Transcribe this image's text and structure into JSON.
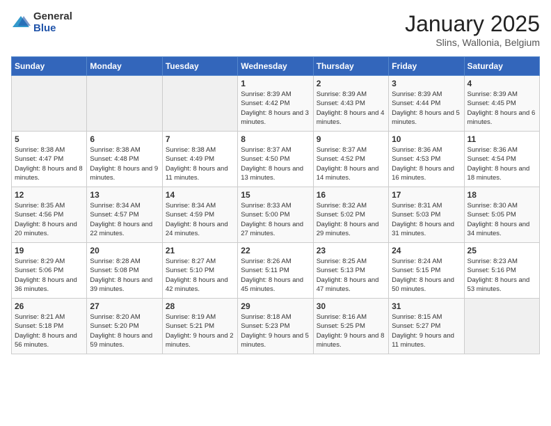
{
  "logo": {
    "general": "General",
    "blue": "Blue"
  },
  "header": {
    "month": "January 2025",
    "location": "Slins, Wallonia, Belgium"
  },
  "weekdays": [
    "Sunday",
    "Monday",
    "Tuesday",
    "Wednesday",
    "Thursday",
    "Friday",
    "Saturday"
  ],
  "weeks": [
    [
      {
        "day": "",
        "sunrise": "",
        "sunset": "",
        "daylight": ""
      },
      {
        "day": "",
        "sunrise": "",
        "sunset": "",
        "daylight": ""
      },
      {
        "day": "",
        "sunrise": "",
        "sunset": "",
        "daylight": ""
      },
      {
        "day": "1",
        "sunrise": "Sunrise: 8:39 AM",
        "sunset": "Sunset: 4:42 PM",
        "daylight": "Daylight: 8 hours and 3 minutes."
      },
      {
        "day": "2",
        "sunrise": "Sunrise: 8:39 AM",
        "sunset": "Sunset: 4:43 PM",
        "daylight": "Daylight: 8 hours and 4 minutes."
      },
      {
        "day": "3",
        "sunrise": "Sunrise: 8:39 AM",
        "sunset": "Sunset: 4:44 PM",
        "daylight": "Daylight: 8 hours and 5 minutes."
      },
      {
        "day": "4",
        "sunrise": "Sunrise: 8:39 AM",
        "sunset": "Sunset: 4:45 PM",
        "daylight": "Daylight: 8 hours and 6 minutes."
      }
    ],
    [
      {
        "day": "5",
        "sunrise": "Sunrise: 8:38 AM",
        "sunset": "Sunset: 4:47 PM",
        "daylight": "Daylight: 8 hours and 8 minutes."
      },
      {
        "day": "6",
        "sunrise": "Sunrise: 8:38 AM",
        "sunset": "Sunset: 4:48 PM",
        "daylight": "Daylight: 8 hours and 9 minutes."
      },
      {
        "day": "7",
        "sunrise": "Sunrise: 8:38 AM",
        "sunset": "Sunset: 4:49 PM",
        "daylight": "Daylight: 8 hours and 11 minutes."
      },
      {
        "day": "8",
        "sunrise": "Sunrise: 8:37 AM",
        "sunset": "Sunset: 4:50 PM",
        "daylight": "Daylight: 8 hours and 13 minutes."
      },
      {
        "day": "9",
        "sunrise": "Sunrise: 8:37 AM",
        "sunset": "Sunset: 4:52 PM",
        "daylight": "Daylight: 8 hours and 14 minutes."
      },
      {
        "day": "10",
        "sunrise": "Sunrise: 8:36 AM",
        "sunset": "Sunset: 4:53 PM",
        "daylight": "Daylight: 8 hours and 16 minutes."
      },
      {
        "day": "11",
        "sunrise": "Sunrise: 8:36 AM",
        "sunset": "Sunset: 4:54 PM",
        "daylight": "Daylight: 8 hours and 18 minutes."
      }
    ],
    [
      {
        "day": "12",
        "sunrise": "Sunrise: 8:35 AM",
        "sunset": "Sunset: 4:56 PM",
        "daylight": "Daylight: 8 hours and 20 minutes."
      },
      {
        "day": "13",
        "sunrise": "Sunrise: 8:34 AM",
        "sunset": "Sunset: 4:57 PM",
        "daylight": "Daylight: 8 hours and 22 minutes."
      },
      {
        "day": "14",
        "sunrise": "Sunrise: 8:34 AM",
        "sunset": "Sunset: 4:59 PM",
        "daylight": "Daylight: 8 hours and 24 minutes."
      },
      {
        "day": "15",
        "sunrise": "Sunrise: 8:33 AM",
        "sunset": "Sunset: 5:00 PM",
        "daylight": "Daylight: 8 hours and 27 minutes."
      },
      {
        "day": "16",
        "sunrise": "Sunrise: 8:32 AM",
        "sunset": "Sunset: 5:02 PM",
        "daylight": "Daylight: 8 hours and 29 minutes."
      },
      {
        "day": "17",
        "sunrise": "Sunrise: 8:31 AM",
        "sunset": "Sunset: 5:03 PM",
        "daylight": "Daylight: 8 hours and 31 minutes."
      },
      {
        "day": "18",
        "sunrise": "Sunrise: 8:30 AM",
        "sunset": "Sunset: 5:05 PM",
        "daylight": "Daylight: 8 hours and 34 minutes."
      }
    ],
    [
      {
        "day": "19",
        "sunrise": "Sunrise: 8:29 AM",
        "sunset": "Sunset: 5:06 PM",
        "daylight": "Daylight: 8 hours and 36 minutes."
      },
      {
        "day": "20",
        "sunrise": "Sunrise: 8:28 AM",
        "sunset": "Sunset: 5:08 PM",
        "daylight": "Daylight: 8 hours and 39 minutes."
      },
      {
        "day": "21",
        "sunrise": "Sunrise: 8:27 AM",
        "sunset": "Sunset: 5:10 PM",
        "daylight": "Daylight: 8 hours and 42 minutes."
      },
      {
        "day": "22",
        "sunrise": "Sunrise: 8:26 AM",
        "sunset": "Sunset: 5:11 PM",
        "daylight": "Daylight: 8 hours and 45 minutes."
      },
      {
        "day": "23",
        "sunrise": "Sunrise: 8:25 AM",
        "sunset": "Sunset: 5:13 PM",
        "daylight": "Daylight: 8 hours and 47 minutes."
      },
      {
        "day": "24",
        "sunrise": "Sunrise: 8:24 AM",
        "sunset": "Sunset: 5:15 PM",
        "daylight": "Daylight: 8 hours and 50 minutes."
      },
      {
        "day": "25",
        "sunrise": "Sunrise: 8:23 AM",
        "sunset": "Sunset: 5:16 PM",
        "daylight": "Daylight: 8 hours and 53 minutes."
      }
    ],
    [
      {
        "day": "26",
        "sunrise": "Sunrise: 8:21 AM",
        "sunset": "Sunset: 5:18 PM",
        "daylight": "Daylight: 8 hours and 56 minutes."
      },
      {
        "day": "27",
        "sunrise": "Sunrise: 8:20 AM",
        "sunset": "Sunset: 5:20 PM",
        "daylight": "Daylight: 8 hours and 59 minutes."
      },
      {
        "day": "28",
        "sunrise": "Sunrise: 8:19 AM",
        "sunset": "Sunset: 5:21 PM",
        "daylight": "Daylight: 9 hours and 2 minutes."
      },
      {
        "day": "29",
        "sunrise": "Sunrise: 8:18 AM",
        "sunset": "Sunset: 5:23 PM",
        "daylight": "Daylight: 9 hours and 5 minutes."
      },
      {
        "day": "30",
        "sunrise": "Sunrise: 8:16 AM",
        "sunset": "Sunset: 5:25 PM",
        "daylight": "Daylight: 9 hours and 8 minutes."
      },
      {
        "day": "31",
        "sunrise": "Sunrise: 8:15 AM",
        "sunset": "Sunset: 5:27 PM",
        "daylight": "Daylight: 9 hours and 11 minutes."
      },
      {
        "day": "",
        "sunrise": "",
        "sunset": "",
        "daylight": ""
      }
    ]
  ]
}
